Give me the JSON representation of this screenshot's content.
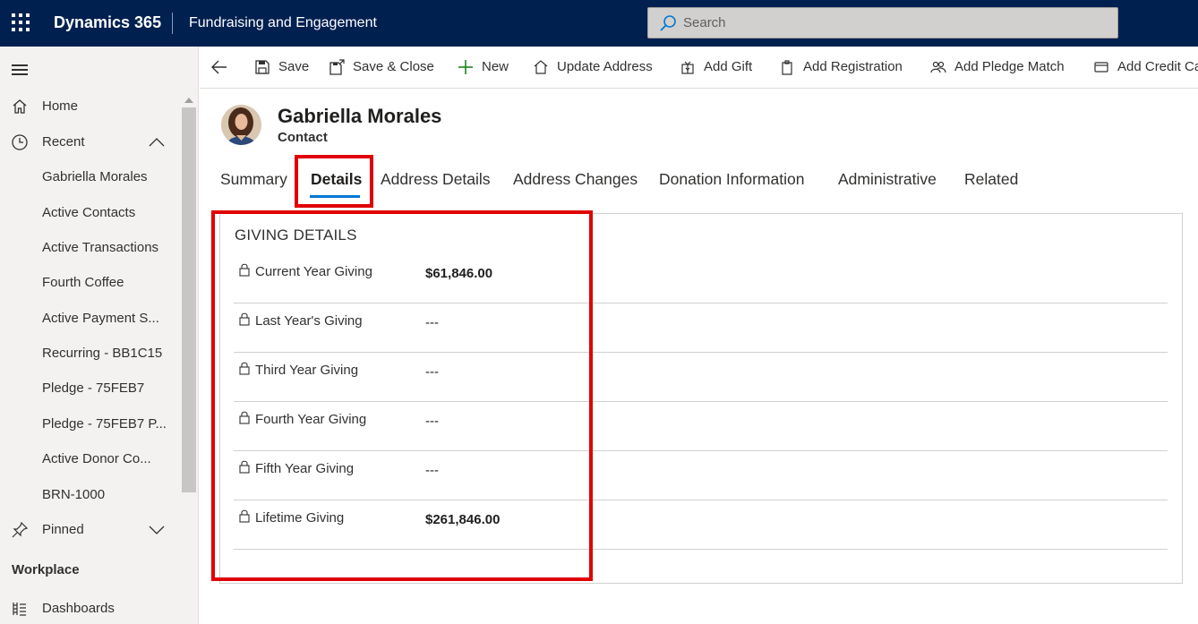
{
  "topbar": {
    "app_name": "Dynamics 365",
    "area_name": "Fundraising and Engagement",
    "search_placeholder": "Search"
  },
  "leftnav": {
    "home": "Home",
    "recent": "Recent",
    "recent_items": [
      "Gabriella Morales",
      "Active Contacts",
      "Active Transactions",
      "Fourth Coffee",
      "Active Payment S...",
      "Recurring - BB1C15",
      "Pledge - 75FEB7",
      "Pledge - 75FEB7 P...",
      "Active Donor Co...",
      "BRN-1000"
    ],
    "pinned": "Pinned",
    "group_workplace": "Workplace",
    "dashboards": "Dashboards"
  },
  "commands": {
    "save": "Save",
    "save_close": "Save & Close",
    "new": "New",
    "update_address": "Update Address",
    "add_gift": "Add Gift",
    "add_registration": "Add Registration",
    "add_pledge_match": "Add Pledge Match",
    "add_credit_card": "Add Credit Card"
  },
  "record": {
    "name": "Gabriella Morales",
    "type": "Contact"
  },
  "tabs": [
    "Summary",
    "Details",
    "Address Details",
    "Address Changes",
    "Donation Information",
    "Administrative",
    "Related"
  ],
  "active_tab": "Details",
  "section": {
    "title": "GIVING DETAILS",
    "fields": [
      {
        "label": "Current Year Giving",
        "value": "$61,846.00"
      },
      {
        "label": "Last Year's Giving",
        "value": "---"
      },
      {
        "label": "Third Year Giving",
        "value": "---"
      },
      {
        "label": "Fourth Year Giving",
        "value": "---"
      },
      {
        "label": "Fifth Year Giving",
        "value": "---"
      },
      {
        "label": "Lifetime Giving",
        "value": "$261,846.00"
      }
    ]
  },
  "colors": {
    "topbar": "#002050",
    "accent": "#0078d4",
    "highlight": "#e00000",
    "nav_bg": "#f3f2f1"
  }
}
